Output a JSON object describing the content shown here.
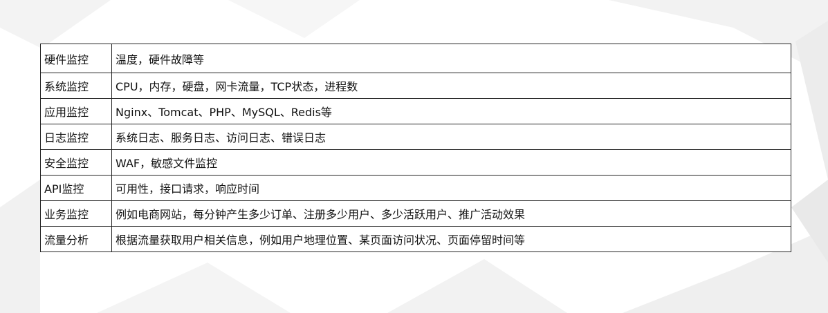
{
  "table": {
    "rows": [
      {
        "category": "硬件监控",
        "detail": "温度，硬件故障等"
      },
      {
        "category": "系统监控",
        "detail": "CPU，内存，硬盘，网卡流量，TCP状态，进程数"
      },
      {
        "category": "应用监控",
        "detail": "Nginx、Tomcat、PHP、MySQL、Redis等"
      },
      {
        "category": "日志监控",
        "detail": "系统日志、服务日志、访问日志、错误日志"
      },
      {
        "category": "安全监控",
        "detail": "WAF，敏感文件监控"
      },
      {
        "category": "API监控",
        "detail": "可用性，接口请求，响应时间"
      },
      {
        "category": "业务监控",
        "detail": "例如电商网站，每分钟产生多少订单、注册多少用户、多少活跃用户、推广活动效果"
      },
      {
        "category": "流量分析",
        "detail": "根据流量获取用户相关信息，例如用户地理位置、某页面访问状况、页面停留时间等"
      }
    ]
  },
  "colors": {
    "border": "#222222",
    "text": "#111111",
    "background": "#ffffff"
  }
}
